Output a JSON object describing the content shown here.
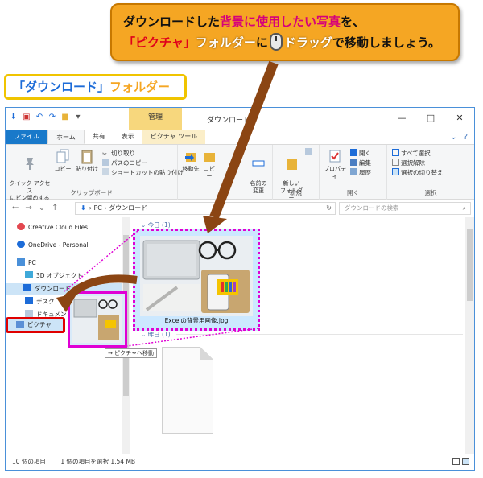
{
  "callout": {
    "line1_a": "ダウンロードした",
    "line1_b": "背景に使用したい写真",
    "line1_c": "を、",
    "line2_a": "「ピクチャ」",
    "line2_b": "フォルダー",
    "line2_c": "に",
    "line2_d": "ドラッグ",
    "line2_e": "で移動しましょう。"
  },
  "folder_label": {
    "quote": "「ダウンロード」",
    "word": "フォルダー"
  },
  "window": {
    "title": "ダウンロード",
    "context_tab": "管理",
    "tabs": [
      "ファイル",
      "ホーム",
      "共有",
      "表示",
      "ピクチャ ツール"
    ],
    "controls": {
      "minimize": "—",
      "maximize": "□",
      "close": "✕"
    },
    "help": "?"
  },
  "ribbon": {
    "clipboard": {
      "quick_access": "クイック アクセス\nにピン留めする",
      "copy": "コピー",
      "paste": "貼り付け",
      "cut": "切り取り",
      "copy_path": "パスのコピー",
      "paste_shortcut": "ショートカットの貼り付け",
      "label": "クリップボード"
    },
    "organize": {
      "move_to": "移動先",
      "copy_to": "コピー",
      "rename": "名前の\n変更"
    },
    "new": {
      "new_folder": "新しい\nフォルダー",
      "label": "新規"
    },
    "open": {
      "properties": "プロパティ",
      "open": "開く",
      "edit": "編集",
      "history": "履歴",
      "label": "開く"
    },
    "select": {
      "select_all": "すべて選択",
      "select_none": "選択解除",
      "invert": "選択の切り替え",
      "label": "選択"
    }
  },
  "address": {
    "path": "›  PC  ›  ダウンロード",
    "search_placeholder": "ダウンロードの検索"
  },
  "nav": {
    "items": [
      "Creative Cloud Files",
      "OneDrive - Personal",
      "PC",
      "3D オブジェクト",
      "ダウンロード",
      "デスク",
      "ドキュメント",
      "ピクチャ"
    ]
  },
  "content": {
    "group_today": "今日 (1)",
    "group_earlier": "昨日 (1)",
    "file_name": "Excelの背景用画像.jpg"
  },
  "drag_tooltip": "→ ピクチャへ移動",
  "status": {
    "count": "10 個の項目",
    "selected": "1 個の項目を選択  1.54 MB"
  }
}
